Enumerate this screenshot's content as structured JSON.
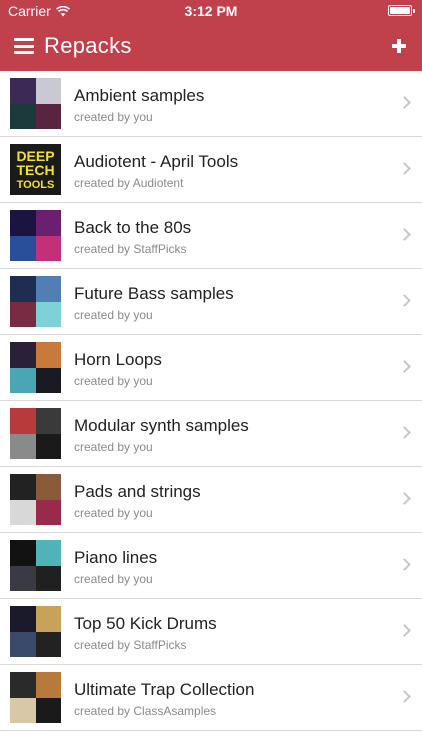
{
  "status_bar": {
    "carrier": "Carrier",
    "time": "3:12 PM"
  },
  "nav": {
    "title": "Repacks"
  },
  "repacks": [
    {
      "title": "Ambient samples",
      "subtitle": "created by you",
      "colors": [
        "#3a2a55",
        "#c9c9d2",
        "#1d3a3a",
        "#5a2440"
      ]
    },
    {
      "title": "Audiotent - April Tools",
      "subtitle": "created by Audiotent",
      "colors": [
        "#1a1a1a"
      ],
      "cover_text": "DEEP TECH TOOLS"
    },
    {
      "title": "Back to the 80s",
      "subtitle": "created by StaffPicks",
      "colors": [
        "#1b1440",
        "#6b1f6e",
        "#2a4f9a",
        "#c42f7a"
      ]
    },
    {
      "title": "Future Bass samples",
      "subtitle": "created by you",
      "colors": [
        "#1d2e52",
        "#4f7fb5",
        "#7a2b44",
        "#7fd1d8"
      ]
    },
    {
      "title": "Horn Loops",
      "subtitle": "created by you",
      "colors": [
        "#2a2038",
        "#c97a3a",
        "#4aa6b5",
        "#1a1a24"
      ]
    },
    {
      "title": "Modular synth samples",
      "subtitle": "created by you",
      "colors": [
        "#b83a3a",
        "#3a3a3a",
        "#8a8a8a",
        "#1a1a1a"
      ]
    },
    {
      "title": "Pads and strings",
      "subtitle": "created by you",
      "colors": [
        "#222222",
        "#8a5b3a",
        "#d8d8d8",
        "#9a2a4a"
      ]
    },
    {
      "title": "Piano lines",
      "subtitle": "created by you",
      "colors": [
        "#121212",
        "#4fb3b8",
        "#3a3a44",
        "#202020"
      ]
    },
    {
      "title": "Top 50 Kick Drums",
      "subtitle": "created by StaffPicks",
      "colors": [
        "#1a1a2a",
        "#c9a25a",
        "#3a4a6a",
        "#222222"
      ]
    },
    {
      "title": "Ultimate Trap Collection",
      "subtitle": "created by ClassAsamples",
      "colors": [
        "#2a2a2a",
        "#b87a3a",
        "#d8c8a8",
        "#1a1a1a"
      ]
    }
  ]
}
